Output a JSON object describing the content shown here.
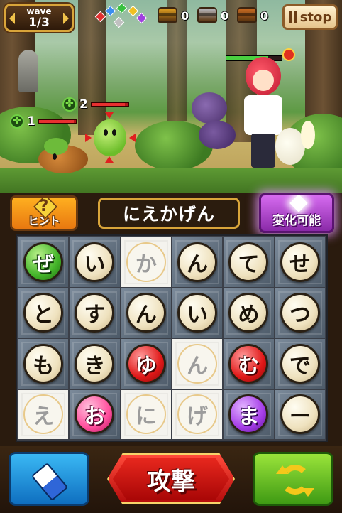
{
  "hud": {
    "wave_label": "wave",
    "wave_value": "1/3",
    "gem_colors": [
      "#e03030",
      "#3a8ef0",
      "#38c040",
      "#f0c020",
      "#a040e0",
      "#c0c0c0"
    ],
    "chests": [
      {
        "color": "#e0a020",
        "count": "0"
      },
      {
        "color": "#b8b8c0",
        "count": "0"
      },
      {
        "color": "#c86a22",
        "count": "0"
      }
    ],
    "stop_label": "stop"
  },
  "battle": {
    "allies": [
      {
        "level": "1",
        "hp": 0.95
      },
      {
        "level": "2",
        "hp": 0.9
      }
    ],
    "enemy_boss_hp": 0.75
  },
  "controls": {
    "hint_symbol": "?",
    "hint_label": "ヒント",
    "current_word": "にえかげん",
    "change_label": "変化可能",
    "attack_label": "攻撃"
  },
  "board": {
    "tiles": [
      {
        "char": "ぜ",
        "style": "green"
      },
      {
        "char": "い",
        "style": "plain"
      },
      {
        "char": "か",
        "style": "faded"
      },
      {
        "char": "ん",
        "style": "plain"
      },
      {
        "char": "て",
        "style": "plain"
      },
      {
        "char": "せ",
        "style": "plain"
      },
      {
        "char": "と",
        "style": "plain"
      },
      {
        "char": "す",
        "style": "plain"
      },
      {
        "char": "ん",
        "style": "plain"
      },
      {
        "char": "い",
        "style": "plain"
      },
      {
        "char": "め",
        "style": "plain"
      },
      {
        "char": "つ",
        "style": "plain"
      },
      {
        "char": "も",
        "style": "plain"
      },
      {
        "char": "き",
        "style": "plain"
      },
      {
        "char": "ゆ",
        "style": "red"
      },
      {
        "char": "ん",
        "style": "faded"
      },
      {
        "char": "む",
        "style": "red"
      },
      {
        "char": "で",
        "style": "plain"
      },
      {
        "char": "え",
        "style": "faded"
      },
      {
        "char": "お",
        "style": "pink"
      },
      {
        "char": "に",
        "style": "faded"
      },
      {
        "char": "げ",
        "style": "faded"
      },
      {
        "char": "ま",
        "style": "purple"
      },
      {
        "char": "ー",
        "style": "plain"
      }
    ]
  }
}
